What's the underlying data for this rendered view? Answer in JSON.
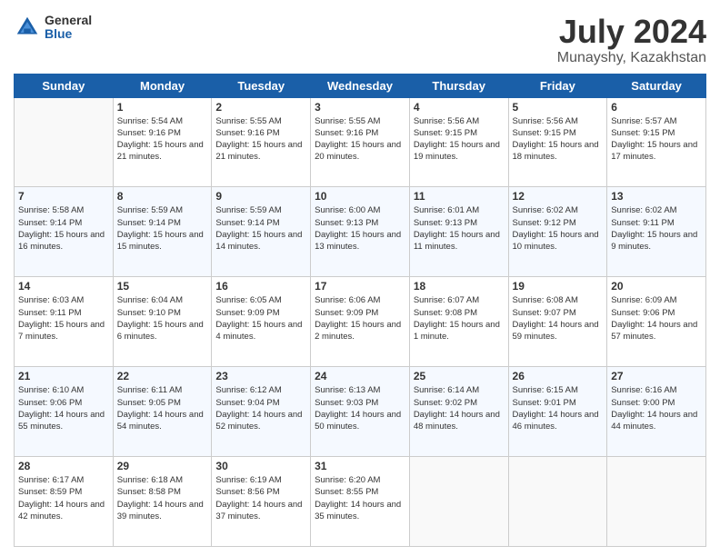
{
  "logo": {
    "general": "General",
    "blue": "Blue"
  },
  "title": "July 2024",
  "subtitle": "Munayshy, Kazakhstan",
  "days_header": [
    "Sunday",
    "Monday",
    "Tuesday",
    "Wednesday",
    "Thursday",
    "Friday",
    "Saturday"
  ],
  "weeks": [
    [
      {
        "day": "",
        "info": ""
      },
      {
        "day": "1",
        "info": "Sunrise: 5:54 AM\nSunset: 9:16 PM\nDaylight: 15 hours\nand 21 minutes."
      },
      {
        "day": "2",
        "info": "Sunrise: 5:55 AM\nSunset: 9:16 PM\nDaylight: 15 hours\nand 21 minutes."
      },
      {
        "day": "3",
        "info": "Sunrise: 5:55 AM\nSunset: 9:16 PM\nDaylight: 15 hours\nand 20 minutes."
      },
      {
        "day": "4",
        "info": "Sunrise: 5:56 AM\nSunset: 9:15 PM\nDaylight: 15 hours\nand 19 minutes."
      },
      {
        "day": "5",
        "info": "Sunrise: 5:56 AM\nSunset: 9:15 PM\nDaylight: 15 hours\nand 18 minutes."
      },
      {
        "day": "6",
        "info": "Sunrise: 5:57 AM\nSunset: 9:15 PM\nDaylight: 15 hours\nand 17 minutes."
      }
    ],
    [
      {
        "day": "7",
        "info": "Sunrise: 5:58 AM\nSunset: 9:14 PM\nDaylight: 15 hours\nand 16 minutes."
      },
      {
        "day": "8",
        "info": "Sunrise: 5:59 AM\nSunset: 9:14 PM\nDaylight: 15 hours\nand 15 minutes."
      },
      {
        "day": "9",
        "info": "Sunrise: 5:59 AM\nSunset: 9:14 PM\nDaylight: 15 hours\nand 14 minutes."
      },
      {
        "day": "10",
        "info": "Sunrise: 6:00 AM\nSunset: 9:13 PM\nDaylight: 15 hours\nand 13 minutes."
      },
      {
        "day": "11",
        "info": "Sunrise: 6:01 AM\nSunset: 9:13 PM\nDaylight: 15 hours\nand 11 minutes."
      },
      {
        "day": "12",
        "info": "Sunrise: 6:02 AM\nSunset: 9:12 PM\nDaylight: 15 hours\nand 10 minutes."
      },
      {
        "day": "13",
        "info": "Sunrise: 6:02 AM\nSunset: 9:11 PM\nDaylight: 15 hours\nand 9 minutes."
      }
    ],
    [
      {
        "day": "14",
        "info": "Sunrise: 6:03 AM\nSunset: 9:11 PM\nDaylight: 15 hours\nand 7 minutes."
      },
      {
        "day": "15",
        "info": "Sunrise: 6:04 AM\nSunset: 9:10 PM\nDaylight: 15 hours\nand 6 minutes."
      },
      {
        "day": "16",
        "info": "Sunrise: 6:05 AM\nSunset: 9:09 PM\nDaylight: 15 hours\nand 4 minutes."
      },
      {
        "day": "17",
        "info": "Sunrise: 6:06 AM\nSunset: 9:09 PM\nDaylight: 15 hours\nand 2 minutes."
      },
      {
        "day": "18",
        "info": "Sunrise: 6:07 AM\nSunset: 9:08 PM\nDaylight: 15 hours\nand 1 minute."
      },
      {
        "day": "19",
        "info": "Sunrise: 6:08 AM\nSunset: 9:07 PM\nDaylight: 14 hours\nand 59 minutes."
      },
      {
        "day": "20",
        "info": "Sunrise: 6:09 AM\nSunset: 9:06 PM\nDaylight: 14 hours\nand 57 minutes."
      }
    ],
    [
      {
        "day": "21",
        "info": "Sunrise: 6:10 AM\nSunset: 9:06 PM\nDaylight: 14 hours\nand 55 minutes."
      },
      {
        "day": "22",
        "info": "Sunrise: 6:11 AM\nSunset: 9:05 PM\nDaylight: 14 hours\nand 54 minutes."
      },
      {
        "day": "23",
        "info": "Sunrise: 6:12 AM\nSunset: 9:04 PM\nDaylight: 14 hours\nand 52 minutes."
      },
      {
        "day": "24",
        "info": "Sunrise: 6:13 AM\nSunset: 9:03 PM\nDaylight: 14 hours\nand 50 minutes."
      },
      {
        "day": "25",
        "info": "Sunrise: 6:14 AM\nSunset: 9:02 PM\nDaylight: 14 hours\nand 48 minutes."
      },
      {
        "day": "26",
        "info": "Sunrise: 6:15 AM\nSunset: 9:01 PM\nDaylight: 14 hours\nand 46 minutes."
      },
      {
        "day": "27",
        "info": "Sunrise: 6:16 AM\nSunset: 9:00 PM\nDaylight: 14 hours\nand 44 minutes."
      }
    ],
    [
      {
        "day": "28",
        "info": "Sunrise: 6:17 AM\nSunset: 8:59 PM\nDaylight: 14 hours\nand 42 minutes."
      },
      {
        "day": "29",
        "info": "Sunrise: 6:18 AM\nSunset: 8:58 PM\nDaylight: 14 hours\nand 39 minutes."
      },
      {
        "day": "30",
        "info": "Sunrise: 6:19 AM\nSunset: 8:56 PM\nDaylight: 14 hours\nand 37 minutes."
      },
      {
        "day": "31",
        "info": "Sunrise: 6:20 AM\nSunset: 8:55 PM\nDaylight: 14 hours\nand 35 minutes."
      },
      {
        "day": "",
        "info": ""
      },
      {
        "day": "",
        "info": ""
      },
      {
        "day": "",
        "info": ""
      }
    ]
  ]
}
